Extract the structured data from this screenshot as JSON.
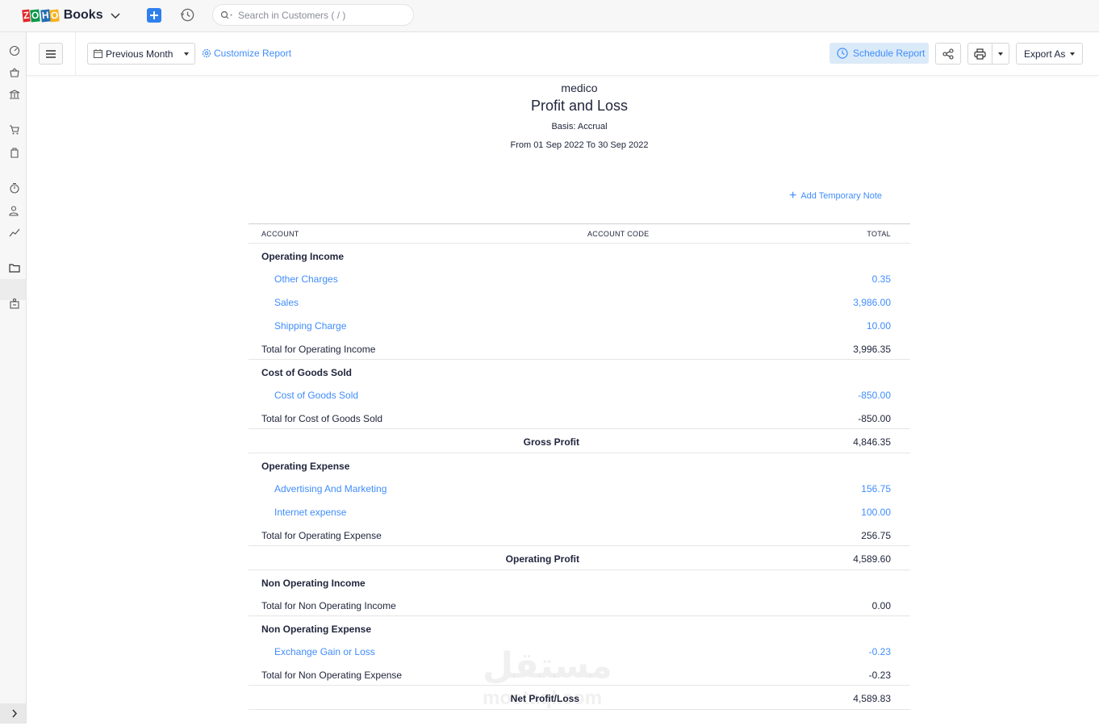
{
  "app": {
    "logo_letters": [
      "Z",
      "O",
      "H",
      "O"
    ],
    "logo_colors": [
      "#e42527",
      "#089949",
      "#226db4",
      "#f9b21d"
    ],
    "brand": "Books",
    "search_placeholder": "Search in Customers ( / )"
  },
  "toolbar": {
    "period": "Previous Month",
    "customize": "Customize Report",
    "schedule": "Schedule Report",
    "export": "Export As"
  },
  "report": {
    "org": "medico",
    "title": "Profit and Loss",
    "basis": "Basis: Accrual",
    "range": "From 01 Sep 2022 To 30 Sep 2022",
    "temp_note": "Add Temporary Note",
    "columns": {
      "account": "ACCOUNT",
      "code": "ACCOUNT CODE",
      "total": "TOTAL"
    },
    "rows": [
      {
        "type": "head",
        "account": "Operating Income",
        "amount": ""
      },
      {
        "type": "child",
        "account": "Other Charges",
        "amount": "0.35"
      },
      {
        "type": "child",
        "account": "Sales",
        "amount": "3,986.00"
      },
      {
        "type": "child",
        "account": "Shipping Charge",
        "amount": "10.00"
      },
      {
        "type": "tot",
        "account": "Total for Operating Income",
        "amount": "3,996.35"
      },
      {
        "type": "head",
        "account": "Cost of Goods Sold",
        "amount": ""
      },
      {
        "type": "child",
        "account": "Cost of Goods Sold",
        "amount": "-850.00"
      },
      {
        "type": "tot",
        "account": "Total for Cost of Goods Sold",
        "amount": "-850.00"
      },
      {
        "type": "summary",
        "account": "Gross Profit",
        "amount": "4,846.35"
      },
      {
        "type": "head",
        "account": "Operating Expense",
        "amount": ""
      },
      {
        "type": "child",
        "account": "Advertising And Marketing",
        "amount": "156.75"
      },
      {
        "type": "child",
        "account": "Internet expense",
        "amount": "100.00"
      },
      {
        "type": "tot",
        "account": "Total for Operating Expense",
        "amount": "256.75"
      },
      {
        "type": "summary",
        "account": "Operating Profit",
        "amount": "4,589.60"
      },
      {
        "type": "head",
        "account": "Non Operating Income",
        "amount": ""
      },
      {
        "type": "tot",
        "account": "Total for Non Operating Income",
        "amount": "0.00"
      },
      {
        "type": "head",
        "account": "Non Operating Expense",
        "amount": ""
      },
      {
        "type": "child",
        "account": "Exchange Gain or Loss",
        "amount": "-0.23"
      },
      {
        "type": "tot",
        "account": "Total for Non Operating Expense",
        "amount": "-0.23"
      },
      {
        "type": "summary",
        "account": "Net Profit/Loss",
        "amount": "4,589.83"
      }
    ]
  },
  "watermark": {
    "arabic": "مستقل",
    "latin": "mostaql.com"
  }
}
